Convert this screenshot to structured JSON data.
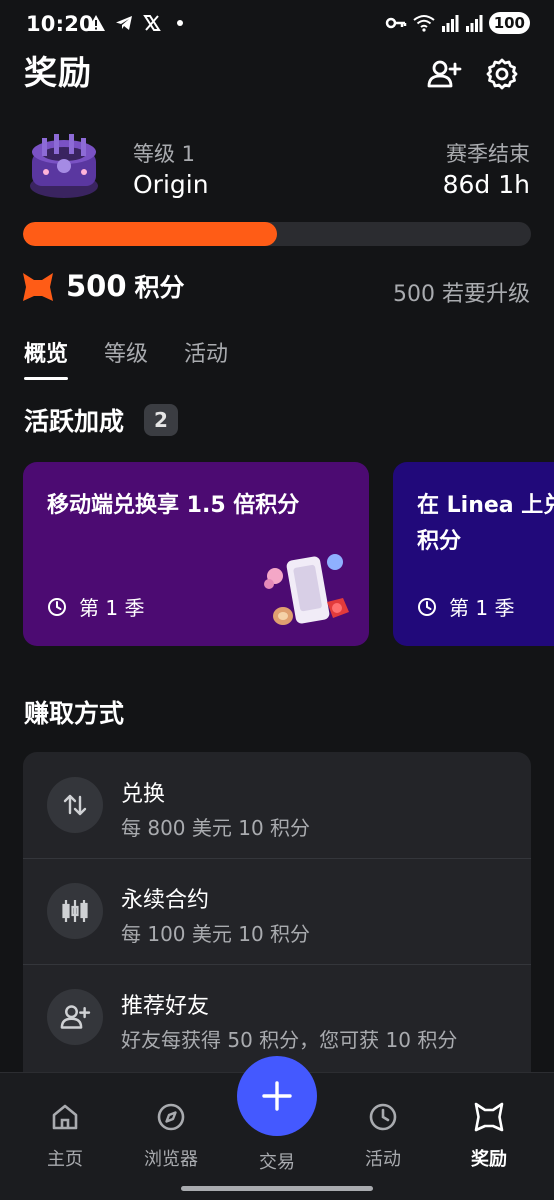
{
  "status_bar": {
    "time": "10:20",
    "left_icons": [
      "warning-icon",
      "telegram-icon",
      "x-logo-icon",
      "dot-icon"
    ],
    "right_icons": [
      "key-icon",
      "wifi-icon",
      "signal-icon",
      "signal-icon"
    ],
    "battery": "100"
  },
  "header": {
    "title": "奖励",
    "add_friend_icon": "add-person-icon",
    "settings_icon": "gear-icon"
  },
  "level": {
    "label": "等级 1",
    "name": "Origin",
    "season_label": "赛季结束",
    "season_remaining": "86d 1h",
    "progress_fraction": 0.5
  },
  "points": {
    "value": "500",
    "unit": "积分",
    "to_upgrade": "500 若要升级"
  },
  "tabs": [
    {
      "label": "概览",
      "active": true
    },
    {
      "label": "等级",
      "active": false
    },
    {
      "label": "活动",
      "active": false
    }
  ],
  "boosts": {
    "title": "活跃加成",
    "count": "2",
    "cards": [
      {
        "title": "移动端兑换享 1.5 倍积分",
        "season": "第 1 季",
        "color": "#4c0b72"
      },
      {
        "title": "在 Linea 上兑\n积分",
        "season": "第 1 季",
        "color": "#21097a"
      }
    ]
  },
  "earn": {
    "title": "赚取方式",
    "items": [
      {
        "title": "兑换",
        "desc": "每 800 美元 10 积分",
        "icon": "swap-icon"
      },
      {
        "title": "永续合约",
        "desc": "每 100 美元 10 积分",
        "icon": "candlestick-icon"
      },
      {
        "title": "推荐好友",
        "desc": "好友每获得 50 积分，您可获 10 积分",
        "icon": "add-person-icon"
      }
    ]
  },
  "nav": {
    "home": "主页",
    "browser": "浏览器",
    "trade": "交易",
    "activity": "活动",
    "rewards": "奖励"
  },
  "colors": {
    "accent": "#ff5c16",
    "fab": "#4459ff",
    "background": "#131416",
    "card": "#232428"
  }
}
